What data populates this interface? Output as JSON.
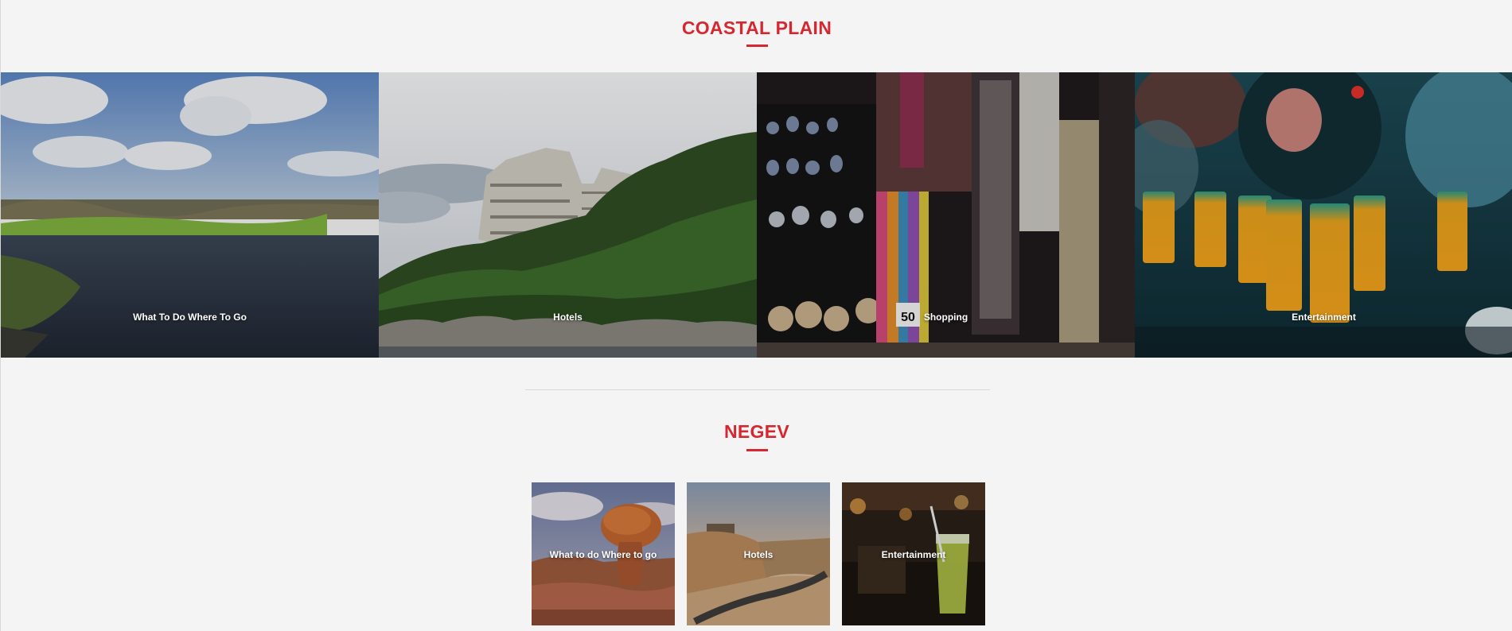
{
  "sections": {
    "coastal": {
      "title": "COASTAL PLAIN",
      "tiles": [
        {
          "label": "What To Do Where To Go",
          "image": "river-landscape"
        },
        {
          "label": "Hotels",
          "image": "cliff-hotel-building"
        },
        {
          "label": "Shopping",
          "image": "market-stall"
        },
        {
          "label": "Entertainment",
          "image": "bar-drinks"
        }
      ]
    },
    "negev": {
      "title": "NEGEV",
      "tiles": [
        {
          "label": "What to do Where to go",
          "image": "desert-rock"
        },
        {
          "label": "Hotels",
          "image": "desert-cliff-road"
        },
        {
          "label": "Entertainment",
          "image": "cocktail-bar"
        }
      ]
    }
  },
  "colors": {
    "accent": "#d6262f",
    "background": "#f4f4f4"
  }
}
